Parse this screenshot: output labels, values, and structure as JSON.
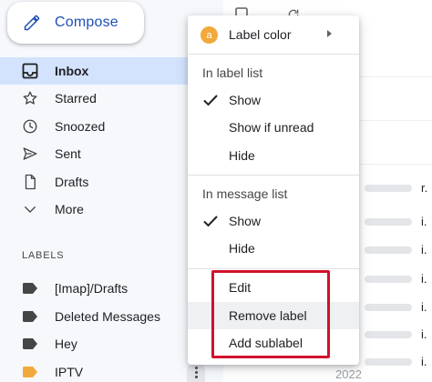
{
  "compose": {
    "label": "Compose"
  },
  "nav": [
    {
      "label": "Inbox",
      "icon": "inbox-icon"
    },
    {
      "label": "Starred",
      "icon": "star-icon"
    },
    {
      "label": "Snoozed",
      "icon": "clock-icon"
    },
    {
      "label": "Sent",
      "icon": "send-icon"
    },
    {
      "label": "Drafts",
      "icon": "draft-icon"
    },
    {
      "label": "More",
      "icon": "chevron-down-icon"
    }
  ],
  "labels": {
    "heading": "LABELS",
    "items": [
      {
        "label": "[Imap]/Drafts",
        "color": "#444746"
      },
      {
        "label": "Deleted Messages",
        "color": "#444746"
      },
      {
        "label": "Hey",
        "color": "#444746"
      },
      {
        "label": "IPTV",
        "color": "#f2a93b"
      }
    ]
  },
  "background_rows": {
    "fragments": [
      "r.",
      "i.",
      "i.",
      "i.",
      "i.",
      "i.",
      "i."
    ],
    "last_row_text": "2022"
  },
  "menu": {
    "label_color": "Label color",
    "label_color_badge": "a",
    "label_color_value": "#f2a93b",
    "in_label_list": {
      "heading": "In label list",
      "options": [
        "Show",
        "Show if unread",
        "Hide"
      ],
      "selected": "Show"
    },
    "in_message_list": {
      "heading": "In message list",
      "options": [
        "Show",
        "Hide"
      ],
      "selected": "Show"
    },
    "actions": [
      "Edit",
      "Remove label",
      "Add sublabel"
    ],
    "hovered_action": "Remove label"
  },
  "highlight_color": "#d0112b"
}
